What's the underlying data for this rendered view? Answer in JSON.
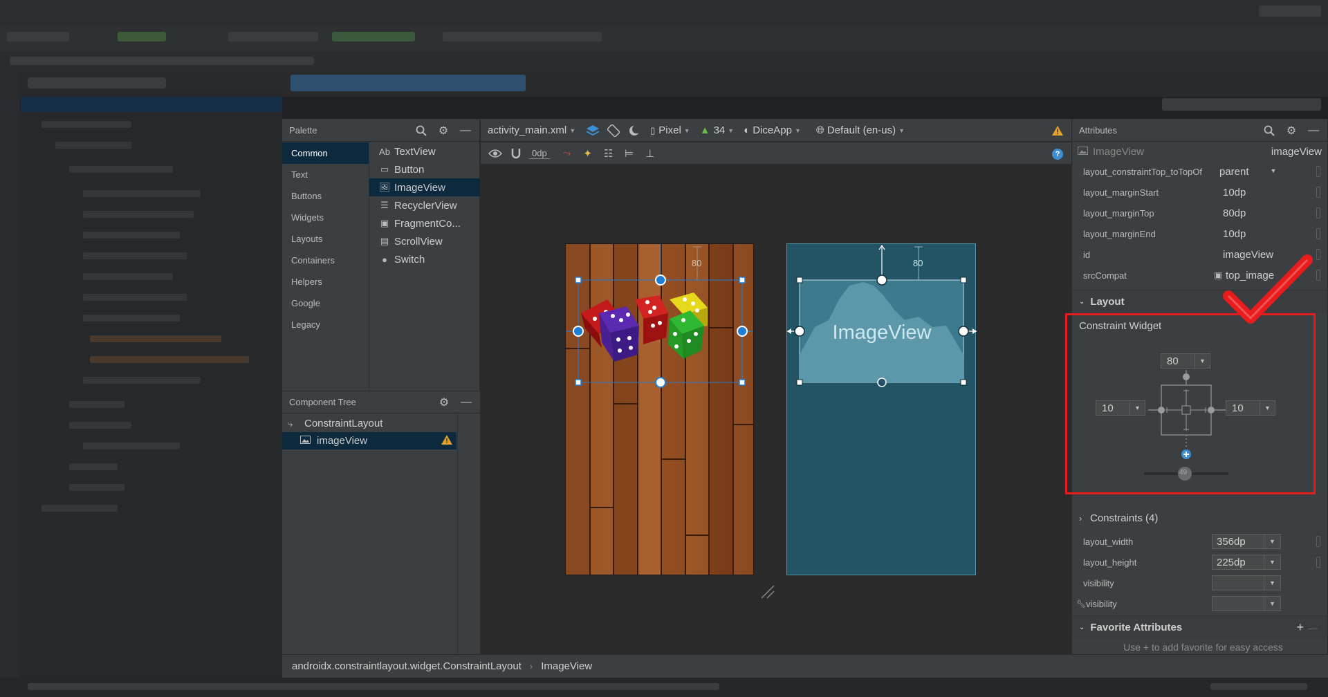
{
  "palette": {
    "title": "Palette",
    "categories": [
      "Common",
      "Text",
      "Buttons",
      "Widgets",
      "Layouts",
      "Containers",
      "Helpers",
      "Google",
      "Legacy"
    ],
    "widgets": [
      {
        "icon": "Ab",
        "label": "TextView"
      },
      {
        "icon": "▭",
        "label": "Button"
      },
      {
        "icon": "🖼",
        "label": "ImageView"
      },
      {
        "icon": "☰",
        "label": "RecyclerView"
      },
      {
        "icon": "▣",
        "label": "FragmentCo..."
      },
      {
        "icon": "▤",
        "label": "ScrollView"
      },
      {
        "icon": "●",
        "label": "Switch"
      }
    ]
  },
  "component_tree": {
    "title": "Component Tree",
    "root": "ConstraintLayout",
    "child": "imageView"
  },
  "toolbar": {
    "file": "activity_main.xml",
    "device": "Pixel",
    "api": "34",
    "theme": "DiceApp",
    "locale": "Default (en-us)",
    "margin": "0dp"
  },
  "canvas": {
    "margin_label": "80",
    "blueprint_label": "ImageView",
    "bp_margin_label": "80"
  },
  "attributes": {
    "title": "Attributes",
    "component_type": "ImageView",
    "component_id": "imageView",
    "rows": [
      {
        "key": "layout_constraintTop_toTopOf",
        "value": "parent",
        "dropdown": true
      },
      {
        "key": "layout_marginStart",
        "value": "10dp"
      },
      {
        "key": "layout_marginTop",
        "value": "80dp"
      },
      {
        "key": "layout_marginEnd",
        "value": "10dp"
      },
      {
        "key": "id",
        "value": "imageView"
      },
      {
        "key": "srcCompat",
        "value": "top_image"
      }
    ],
    "layout_section": "Layout",
    "constraint_widget": {
      "title": "Constraint Widget",
      "top": "80",
      "left": "10",
      "right": "10",
      "bias": "49"
    },
    "constraints_section": "Constraints (4)",
    "layout_rows": [
      {
        "key": "layout_width",
        "value": "356dp"
      },
      {
        "key": "layout_height",
        "value": "225dp"
      },
      {
        "key": "visibility",
        "value": ""
      },
      {
        "key": "visibility",
        "value": "",
        "tool": true
      }
    ],
    "favorites_section": "Favorite Attributes",
    "favorites_hint": "Use + to add favorite for easy access"
  },
  "breadcrumb": {
    "path": "androidx.constraintlayout.widget.ConstraintLayout",
    "leaf": "ImageView"
  },
  "colors": {
    "selection": "#0d293e",
    "highlight_box": "#e81c1c",
    "blueprint": "#235466",
    "handle": "#1f7ed6"
  }
}
